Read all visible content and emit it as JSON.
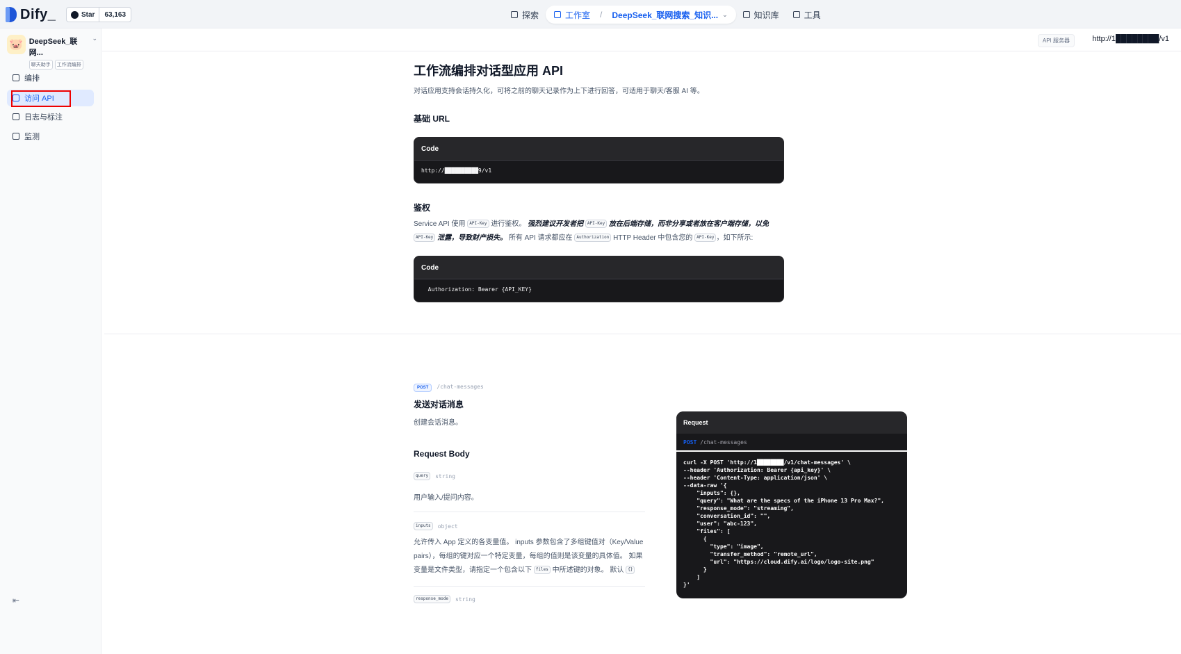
{
  "brand": {
    "name": "Dify_"
  },
  "github": {
    "star_label": "Star",
    "star_count": "63,163"
  },
  "topnav": {
    "explore": "探索",
    "studio": "工作室",
    "app_name": "DeepSeek_联网搜索_知识...",
    "knowledge": "知识库",
    "tools": "工具"
  },
  "sidebar": {
    "app_name": "DeepSeek_联网...",
    "badges": [
      "聊天助手",
      "工作流编排"
    ],
    "items": [
      {
        "label": "编排"
      },
      {
        "label": "访问 API"
      },
      {
        "label": "日志与标注"
      },
      {
        "label": "监测"
      }
    ]
  },
  "header": {
    "api_server_label": "API 服务器",
    "api_url": "http://1████████/v1"
  },
  "doc": {
    "title": "工作流编排对话型应用 API",
    "subtitle": "对话应用支持会话持久化，可将之前的聊天记录作为上下进行回答，可适用于聊天/客服 AI 等。",
    "base_url_heading": "基础 URL",
    "code_label": "Code",
    "base_url_code": "http://██████████9/v1",
    "auth_heading": "鉴权",
    "auth_text_1": "Service API 使用",
    "auth_tag_api_key": "API-Key",
    "auth_text_2": "进行鉴权。",
    "auth_em_1": "强烈建议开发者把",
    "auth_em_2": "放在后端存储，而非分享或者放在客户端存储，以免",
    "auth_tag_api_key_wrap": "API-Key",
    "auth_em_3": "泄露，导致财产损失。",
    "auth_text_3": "所有 API 请求都应在",
    "auth_tag_authorization": "Authorization",
    "auth_text_4": "HTTP Header 中包含您的",
    "auth_text_5": "，如下所示:",
    "auth_code": "  Authorization: Bearer {API_KEY}",
    "method": "POST",
    "route": "/chat-messages",
    "send_heading": "发送对话消息",
    "send_desc": "创建会话消息。",
    "request_body_heading": "Request Body",
    "fields": [
      {
        "name": "query",
        "type": "string",
        "desc": "用户输入/提问内容。"
      },
      {
        "name": "inputs",
        "type": "object",
        "desc": "允许传入 App 定义的各变量值。 inputs 参数包含了多组键值对（Key/Value pairs），每组的键对应一个特定变量，每组的值则是该变量的具体值。 如果变量是文件类型，请指定一个包含以下",
        "tag_files": "files",
        "desc_tail": "中所述键的对象。 默认",
        "tag_default": "{}"
      },
      {
        "name": "response_mode",
        "type": "string"
      }
    ]
  },
  "request": {
    "heading": "Request",
    "method": "POST",
    "route": "/chat-messages",
    "code": "curl -X POST 'http://1████████/v1/chat-messages' \\\n--header 'Authorization: Bearer {api_key}' \\\n--header 'Content-Type: application/json' \\\n--data-raw '{\n    \"inputs\": {},\n    \"query\": \"What are the specs of the iPhone 13 Pro Max?\",\n    \"response_mode\": \"streaming\",\n    \"conversation_id\": \"\",\n    \"user\": \"abc-123\",\n    \"files\": [\n      {\n        \"type\": \"image\",\n        \"transfer_method\": \"remote_url\",\n        \"url\": \"https://cloud.dify.ai/logo/logo-site.png\"\n      }\n    ]\n}'"
  },
  "colors": {
    "accent": "#155eef",
    "code_bg": "#18181b",
    "highlight_box": "#ee0000"
  }
}
